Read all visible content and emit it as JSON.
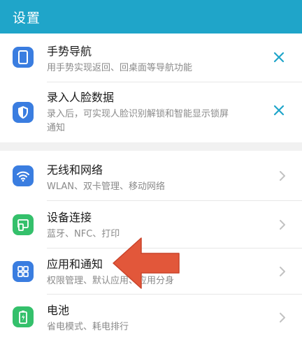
{
  "header": {
    "title": "设置"
  },
  "colors": {
    "header_bg": "#1fa5c9",
    "accent": "#1fa5c9",
    "icon_blue": "#3a7de0",
    "icon_green": "#34c06b",
    "arrow": "#e2573a"
  },
  "suggestions": [
    {
      "title": "手势导航",
      "subtitle": "用手势实现返回、回桌面等导航功能",
      "icon": "phone-icon"
    },
    {
      "title": "录入人脸数据",
      "subtitle_line1": "录入后，可实现人脸识别解锁和智能显示锁屏",
      "subtitle_line2": "通知",
      "icon": "shield-icon"
    }
  ],
  "settings": [
    {
      "title": "无线和网络",
      "subtitle": "WLAN、双卡管理、移动网络",
      "icon": "wifi-icon"
    },
    {
      "title": "设备连接",
      "subtitle": "蓝牙、NFC、打印",
      "icon": "device-connect-icon"
    },
    {
      "title": "应用和通知",
      "subtitle": "权限管理、默认应用、应用分身",
      "icon": "apps-grid-icon"
    },
    {
      "title": "电池",
      "subtitle": "省电模式、耗电排行",
      "icon": "battery-icon"
    }
  ]
}
